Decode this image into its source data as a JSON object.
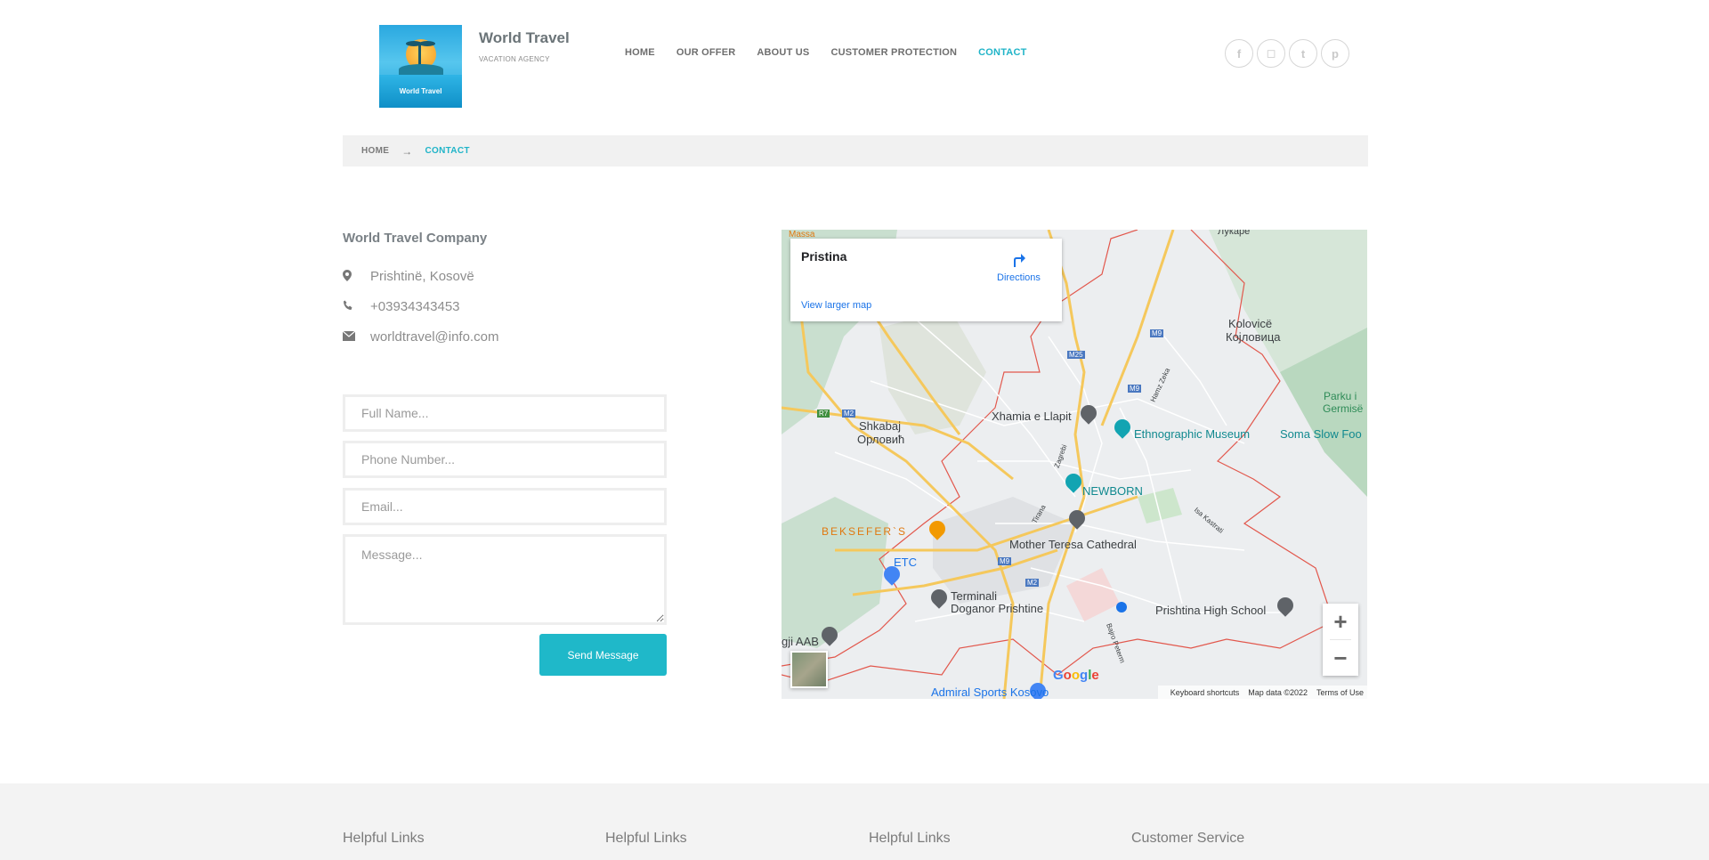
{
  "brand": {
    "logo_text": "World Travel",
    "name": "World Travel",
    "tagline": "VACATION AGENCY"
  },
  "nav": {
    "items": [
      {
        "label": "HOME"
      },
      {
        "label": "OUR OFFER"
      },
      {
        "label": "ABOUT US"
      },
      {
        "label": "CUSTOMER PROTECTION"
      },
      {
        "label": "CONTACT"
      }
    ],
    "active": "CONTACT"
  },
  "socials": [
    {
      "icon": "facebook-icon",
      "glyph": "f"
    },
    {
      "icon": "instagram-icon",
      "glyph": "◻"
    },
    {
      "icon": "twitter-icon",
      "glyph": "t"
    },
    {
      "icon": "pinterest-icon",
      "glyph": "p"
    }
  ],
  "breadcrumb": {
    "home": "HOME",
    "arrow": "→",
    "current": "CONTACT"
  },
  "contact": {
    "company": "World Travel Company",
    "address": "Prishtinë, Kosovë",
    "phone": "+03934343453",
    "email": "worldtravel@info.com"
  },
  "form": {
    "name_placeholder": "Full Name...",
    "phone_placeholder": "Phone Number...",
    "email_placeholder": "Email...",
    "message_placeholder": "Message...",
    "send_label": "Send Message"
  },
  "map": {
    "place": "Pristina",
    "directions": "Directions",
    "larger_map": "View larger map",
    "labels": {
      "massa": "Massa",
      "lukare": "Лукаре",
      "kolovice": "Kolovicë",
      "kojlovica": "Којловица",
      "m9_top": "M9",
      "m25": "M25",
      "m9_mid": "M9",
      "hamz": "Hamz Zeka",
      "parku": "Parku i",
      "germise": "Germisë",
      "r7": "R7",
      "m2_left": "M2",
      "xhamia": "Xhamia e Llapit",
      "ethno": "Ethnographic Museum",
      "soma": "Soma Slow Foo",
      "shkabaj": "Shkabaj",
      "orlovic": "Орловић",
      "zagrebi": "Zagrebi",
      "newborn": "NEWBORN",
      "tirana": "Tirana",
      "isa": "Isa Kastrati",
      "beksefer": "BEKSEFER`S",
      "mother": "Mother Teresa Cathedral",
      "etc": "ETC",
      "m9_low": "M9",
      "m2_low": "M2",
      "terminali": "Terminali",
      "doganor": "Doganor Prishtine",
      "high_school": "Prishtina High School",
      "aab": "gji AAB",
      "admiral": "Admiral Sports Kosovo",
      "bajro": "Bajro Peterm"
    },
    "footer": {
      "shortcuts": "Keyboard shortcuts",
      "data": "Map data ©2022",
      "terms": "Terms of Use"
    },
    "google": "Google"
  },
  "footer": {
    "columns": [
      "Helpful Links",
      "Helpful Links",
      "Helpful Links",
      "Customer Service"
    ]
  },
  "colors": {
    "accent": "#1fb8c9",
    "text": "#7a8186",
    "footer_bg": "#f3f3f3"
  }
}
